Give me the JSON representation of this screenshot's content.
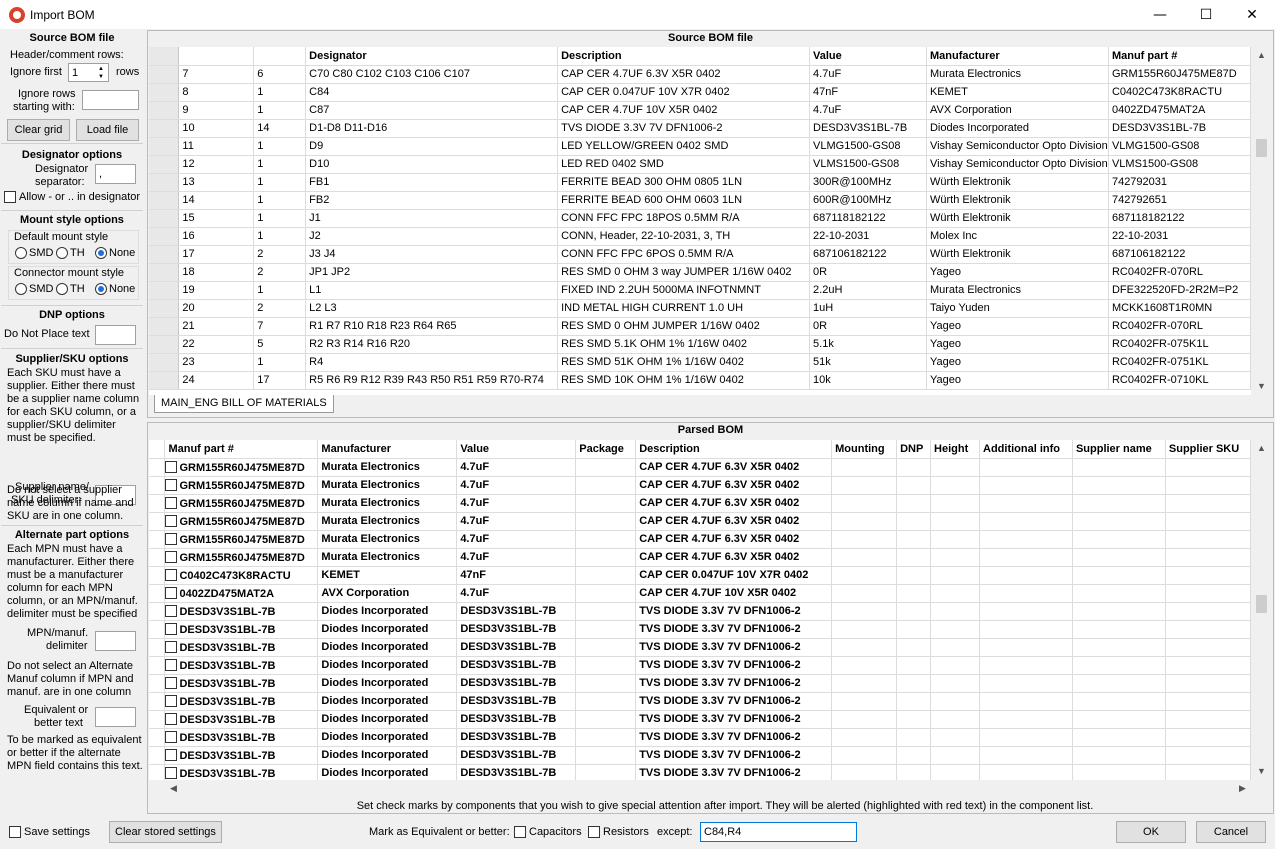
{
  "window": {
    "title": "Import BOM",
    "min": "—",
    "max": "☐",
    "close": "✕"
  },
  "left": {
    "source_heading": "Source BOM file",
    "header_rows_label": "Header/comment rows:",
    "ignore_first_label": "Ignore first",
    "ignore_first_value": "1",
    "rows_label": "rows",
    "ignore_rows_label1": "Ignore rows",
    "ignore_rows_label2": "starting with:",
    "clear_grid": "Clear grid",
    "load_file": "Load file",
    "designator_heading": "Designator options",
    "designator_sep_label1": "Designator",
    "designator_sep_label2": "separator:",
    "designator_sep_value": ",",
    "allow_label": "Allow - or .. in designator",
    "mount_heading": "Mount style options",
    "default_mount_label": "Default mount style",
    "connector_mount_label": "Connector mount style",
    "smd": "SMD",
    "th": "TH",
    "none": "None",
    "dnp_heading": "DNP options",
    "dnp_label": "Do Not Place text",
    "supplier_heading": "Supplier/SKU options",
    "supplier_text1": "Each SKU must have a",
    "supplier_text2": "supplier. Either there must",
    "supplier_text3": "be a supplier name column",
    "supplier_text4": "for each SKU column, or a",
    "supplier_text5": "supplier/SKU delimiter",
    "supplier_text6": "must be specified.",
    "supplier_delim_label1": "Supplier name/",
    "supplier_delim_label2": "SKU delimiter:",
    "supplier_note1": "Do not select a supplier",
    "supplier_note2": "name column if name and",
    "supplier_note3": "SKU are in one column.",
    "alt_heading": "Alternate part options",
    "alt_text1": "Each MPN must have a",
    "alt_text2": "manufacturer. Either there",
    "alt_text3": "must be a manufacturer",
    "alt_text4": "column for each MPN",
    "alt_text5": "column, or an MPN/manuf.",
    "alt_text6": "delimiter must be specified",
    "mpn_delim_label1": "MPN/manuf.",
    "mpn_delim_label2": "delimiter",
    "alt_note1": "Do not select an Alternate",
    "alt_note2": "Manuf column if MPN and",
    "alt_note3": "manuf. are in one column",
    "equiv_label1": "Equivalent or",
    "equiv_label2": "better text",
    "equiv_note1": "To be marked as equivalent",
    "equiv_note2": "or better if the alternate",
    "equiv_note3": "MPN field contains this text."
  },
  "source": {
    "heading": "Source BOM file",
    "columns": [
      "",
      "",
      "Designator",
      "Description",
      "Value",
      "Manufacturer",
      "Manuf part #"
    ],
    "rows": [
      [
        "7",
        "6",
        "C70 C80 C102 C103 C106 C107",
        "CAP CER 4.7UF 6.3V X5R 0402",
        "4.7uF",
        "Murata Electronics",
        "GRM155R60J475ME87D"
      ],
      [
        "8",
        "1",
        "C84",
        "CAP CER 0.047UF 10V X7R 0402",
        "47nF",
        "KEMET",
        "C0402C473K8RACTU"
      ],
      [
        "9",
        "1",
        "C87",
        "CAP CER 4.7UF 10V X5R 0402",
        "4.7uF",
        "AVX Corporation",
        "0402ZD475MAT2A"
      ],
      [
        "10",
        "14",
        "D1-D8 D11-D16",
        "TVS DIODE 3.3V 7V DFN1006-2",
        "DESD3V3S1BL-7B",
        "Diodes Incorporated",
        "DESD3V3S1BL-7B"
      ],
      [
        "11",
        "1",
        "D9",
        "LED YELLOW/GREEN 0402 SMD",
        "VLMG1500-GS08",
        "Vishay Semiconductor Opto Division",
        "VLMG1500-GS08"
      ],
      [
        "12",
        "1",
        "D10",
        "LED RED 0402 SMD",
        "VLMS1500-GS08",
        "Vishay Semiconductor Opto Division",
        "VLMS1500-GS08"
      ],
      [
        "13",
        "1",
        "FB1",
        "FERRITE BEAD 300 OHM 0805 1LN",
        "300R@100MHz",
        "Würth Elektronik",
        "742792031"
      ],
      [
        "14",
        "1",
        "FB2",
        "FERRITE BEAD 600 OHM 0603 1LN",
        "600R@100MHz",
        "Würth Elektronik",
        "742792651"
      ],
      [
        "15",
        "1",
        "J1",
        "CONN FFC FPC 18POS 0.5MM R/A",
        "687118182122",
        "Würth Elektronik",
        "687118182122"
      ],
      [
        "16",
        "1",
        "J2",
        "CONN, Header, 22-10-2031, 3, TH",
        "22-10-2031",
        "Molex Inc",
        "22-10-2031"
      ],
      [
        "17",
        "2",
        "J3 J4",
        "CONN FFC FPC 6POS 0.5MM R/A",
        "687106182122",
        "Würth Elektronik",
        "687106182122"
      ],
      [
        "18",
        "2",
        "JP1 JP2",
        "RES SMD 0 OHM 3 way JUMPER 1/16W 0402",
        "0R",
        "Yageo",
        "RC0402FR-070RL"
      ],
      [
        "19",
        "1",
        "L1",
        "FIXED IND 2.2UH 5000MA INFOTNMNT",
        "2.2uH",
        "Murata Electronics",
        "DFE322520FD-2R2M=P2"
      ],
      [
        "20",
        "2",
        "L2 L3",
        "IND METAL HIGH CURRENT 1.0 UH",
        "1uH",
        "Taiyo Yuden",
        "MCKK1608T1R0MN"
      ],
      [
        "21",
        "7",
        "R1 R7 R10 R18 R23 R64 R65",
        "RES SMD 0 OHM JUMPER 1/16W 0402",
        "0R",
        "Yageo",
        "RC0402FR-070RL"
      ],
      [
        "22",
        "5",
        "R2 R3 R14 R16 R20",
        "RES SMD 5.1K OHM 1% 1/16W 0402",
        "5.1k",
        "Yageo",
        "RC0402FR-075K1L"
      ],
      [
        "23",
        "1",
        "R4",
        "RES SMD 51K OHM 1% 1/16W 0402",
        "51k",
        "Yageo",
        "RC0402FR-0751KL"
      ],
      [
        "24",
        "17",
        "R5 R6 R9 R12 R39 R43 R50 R51 R59 R70-R74",
        "RES SMD 10K OHM 1% 1/16W 0402",
        "10k",
        "Yageo",
        "RC0402FR-0710KL"
      ]
    ],
    "tab": "MAIN_ENG BILL OF MATERIALS"
  },
  "parsed": {
    "heading": "Parsed BOM",
    "columns": [
      "Manuf part #",
      "Manufacturer",
      "Value",
      "Package",
      "Description",
      "Mounting",
      "DNP",
      "Height",
      "Additional info",
      "Supplier name",
      "Supplier SKU"
    ],
    "rows": [
      [
        "GRM155R60J475ME87D",
        "Murata Electronics",
        "4.7uF",
        "",
        "CAP CER 4.7UF 6.3V X5R 0402"
      ],
      [
        "GRM155R60J475ME87D",
        "Murata Electronics",
        "4.7uF",
        "",
        "CAP CER 4.7UF 6.3V X5R 0402"
      ],
      [
        "GRM155R60J475ME87D",
        "Murata Electronics",
        "4.7uF",
        "",
        "CAP CER 4.7UF 6.3V X5R 0402"
      ],
      [
        "GRM155R60J475ME87D",
        "Murata Electronics",
        "4.7uF",
        "",
        "CAP CER 4.7UF 6.3V X5R 0402"
      ],
      [
        "GRM155R60J475ME87D",
        "Murata Electronics",
        "4.7uF",
        "",
        "CAP CER 4.7UF 6.3V X5R 0402"
      ],
      [
        "GRM155R60J475ME87D",
        "Murata Electronics",
        "4.7uF",
        "",
        "CAP CER 4.7UF 6.3V X5R 0402"
      ],
      [
        "C0402C473K8RACTU",
        "KEMET",
        "47nF",
        "",
        "CAP CER 0.047UF 10V X7R 0402"
      ],
      [
        "0402ZD475MAT2A",
        "AVX Corporation",
        "4.7uF",
        "",
        "CAP CER 4.7UF 10V X5R 0402"
      ],
      [
        "DESD3V3S1BL-7B",
        "Diodes Incorporated",
        "DESD3V3S1BL-7B",
        "",
        "TVS DIODE 3.3V 7V DFN1006-2"
      ],
      [
        "DESD3V3S1BL-7B",
        "Diodes Incorporated",
        "DESD3V3S1BL-7B",
        "",
        "TVS DIODE 3.3V 7V DFN1006-2"
      ],
      [
        "DESD3V3S1BL-7B",
        "Diodes Incorporated",
        "DESD3V3S1BL-7B",
        "",
        "TVS DIODE 3.3V 7V DFN1006-2"
      ],
      [
        "DESD3V3S1BL-7B",
        "Diodes Incorporated",
        "DESD3V3S1BL-7B",
        "",
        "TVS DIODE 3.3V 7V DFN1006-2"
      ],
      [
        "DESD3V3S1BL-7B",
        "Diodes Incorporated",
        "DESD3V3S1BL-7B",
        "",
        "TVS DIODE 3.3V 7V DFN1006-2"
      ],
      [
        "DESD3V3S1BL-7B",
        "Diodes Incorporated",
        "DESD3V3S1BL-7B",
        "",
        "TVS DIODE 3.3V 7V DFN1006-2"
      ],
      [
        "DESD3V3S1BL-7B",
        "Diodes Incorporated",
        "DESD3V3S1BL-7B",
        "",
        "TVS DIODE 3.3V 7V DFN1006-2"
      ],
      [
        "DESD3V3S1BL-7B",
        "Diodes Incorporated",
        "DESD3V3S1BL-7B",
        "",
        "TVS DIODE 3.3V 7V DFN1006-2"
      ],
      [
        "DESD3V3S1BL-7B",
        "Diodes Incorporated",
        "DESD3V3S1BL-7B",
        "",
        "TVS DIODE 3.3V 7V DFN1006-2"
      ],
      [
        "DESD3V3S1BL-7B",
        "Diodes Incorporated",
        "DESD3V3S1BL-7B",
        "",
        "TVS DIODE 3.3V 7V DFN1006-2"
      ]
    ]
  },
  "note": "Set check marks by components that you wish to give special attention after import. They will be alerted (highlighted with red text) in the component list.",
  "bottom": {
    "save_settings": "Save settings",
    "clear_stored": "Clear stored settings",
    "mark_label": "Mark as Equivalent or better:",
    "capacitors": "Capacitors",
    "resistors": "Resistors",
    "except_label": "except:",
    "except_value": "C84,R4",
    "ok": "OK",
    "cancel": "Cancel"
  }
}
